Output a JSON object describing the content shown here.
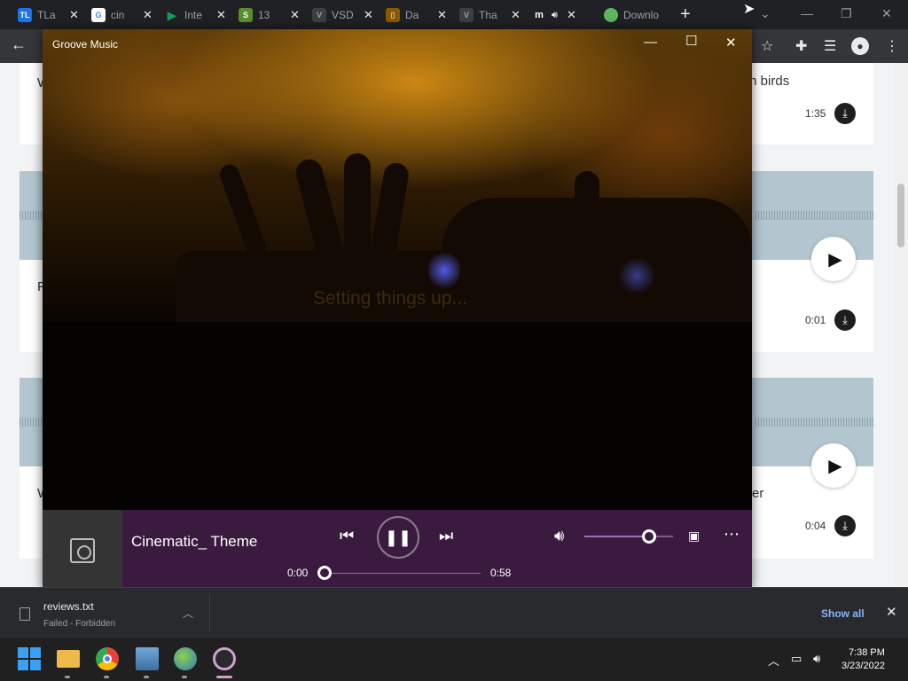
{
  "browser": {
    "tabs": [
      {
        "label": "TLa",
        "favicon": "TL",
        "color": "#1a73e8"
      },
      {
        "label": "cin",
        "favicon": "G",
        "color": "#ffffff"
      },
      {
        "label": "Inte",
        "favicon": "▶",
        "color": "#0f9d58"
      },
      {
        "label": "13",
        "favicon": "S",
        "color": "#5a8f2c"
      },
      {
        "label": "VSD",
        "favicon": "V",
        "color": "#3c4043"
      },
      {
        "label": "Da",
        "favicon": "▯",
        "color": "#8a5a00"
      },
      {
        "label": "Tha",
        "favicon": "V",
        "color": "#3c4043"
      },
      {
        "label": "",
        "favicon": "m",
        "color": "#202124"
      },
      {
        "label": "Downlo",
        "favicon": "●",
        "color": "#5cb85c"
      }
    ],
    "new_tab": "+",
    "back": "←"
  },
  "page": {
    "cards": [
      {
        "title": "th birds",
        "duration": "1:35"
      },
      {
        "title": "",
        "duration": "0:01"
      },
      {
        "title": "er",
        "duration": "0:04"
      }
    ],
    "edge_letters": [
      "W",
      "F",
      "W"
    ]
  },
  "groove": {
    "title": "Groove Music",
    "loading": "Setting things up...",
    "song": "Cinematic_ Theme",
    "time_elapsed": "0:00",
    "time_total": "0:58",
    "volume_percent": 73,
    "seek_percent": 0
  },
  "downloads": {
    "file": "reviews.txt",
    "status": "Failed - Forbidden",
    "show_all": "Show all"
  },
  "taskbar": {
    "time": "7:38 PM",
    "date": "3/23/2022"
  }
}
